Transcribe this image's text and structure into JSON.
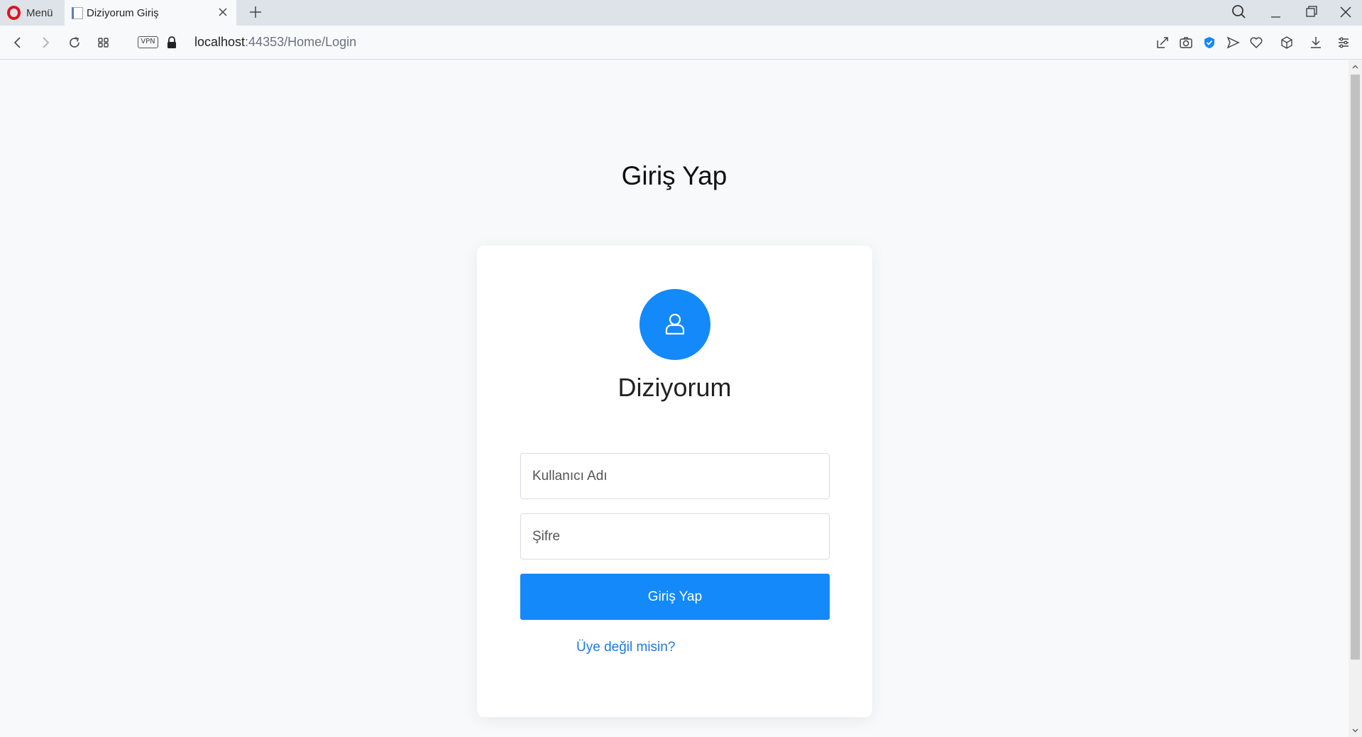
{
  "browser": {
    "menu_label": "Menü",
    "tab_title": "Diziyorum Giriş",
    "vpn_label": "VPN",
    "url_host": "localhost",
    "url_path": ":44353/Home/Login"
  },
  "page": {
    "title": "Giriş Yap",
    "brand": "Diziyorum",
    "username_placeholder": "Kullanıcı Adı",
    "password_placeholder": "Şifre",
    "login_button": "Giriş Yap",
    "register_link": "Üye değil misin?"
  },
  "colors": {
    "accent": "#1389fa",
    "link": "#1a7be0",
    "background": "#f8f9fb",
    "opera_red": "#e2121d"
  },
  "icons": [
    "opera-logo-icon",
    "page-favicon-icon",
    "close-icon",
    "plus-icon",
    "search-icon",
    "minimize-icon",
    "restore-icon",
    "back-icon",
    "forward-icon",
    "reload-icon",
    "speed-dial-icon",
    "lock-icon",
    "snapshot-icon",
    "camera-icon",
    "adblock-shield-icon",
    "send-icon",
    "heart-icon",
    "cube-icon",
    "download-icon",
    "settings-icon",
    "user-icon"
  ]
}
